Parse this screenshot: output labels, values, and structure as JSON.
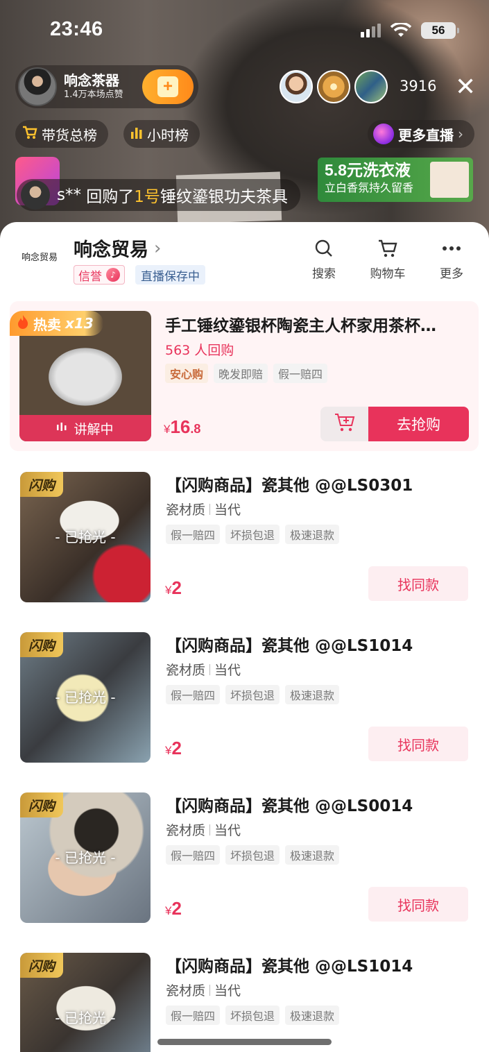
{
  "status": {
    "time": "23:46",
    "battery": "56"
  },
  "host": {
    "name": "响念茶器",
    "likes": "1.4万本场点赞",
    "follow_icon": "plus-heart-icon"
  },
  "viewers": {
    "count": "3916"
  },
  "chips": {
    "sales_rank": "带货总榜",
    "hour_rank": "小时榜",
    "more_live": "更多直播"
  },
  "ad": {
    "title": "5.8元洗衣液",
    "subtitle": "立白香氛持久留香"
  },
  "notice": {
    "user": "s**",
    "action_pre": "回购了",
    "num": "1号",
    "product": "锤纹鎏银功夫茶具"
  },
  "shop": {
    "logo_text": "响念贸易",
    "name": "响念贸易",
    "credit_tag": "信誉",
    "save_tag": "直播保存中",
    "actions": [
      {
        "label": "搜索",
        "icon": "search-icon"
      },
      {
        "label": "购物车",
        "icon": "cart-icon"
      },
      {
        "label": "更多",
        "icon": "more-dots-icon"
      }
    ]
  },
  "featured": {
    "hot_label": "热卖",
    "hot_count": "x13",
    "title": "手工锤纹鎏银杯陶瓷主人杯家用茶杯…",
    "repurchase": "563 人回购",
    "tags": [
      "安心购",
      "晚发即赔",
      "假一赔四"
    ],
    "explain_label": "讲解中",
    "price_symbol": "¥",
    "price_int": "16",
    "price_dec": ".8",
    "buy_label": "去抢购"
  },
  "items": [
    {
      "flash": "闪购",
      "soldout": "- 已抢光 -",
      "title": "【闪购商品】瓷其他 @@LS0301",
      "material": "瓷材质",
      "era": "当代",
      "tags": [
        "假一赔四",
        "坏损包退",
        "极速退款"
      ],
      "price_symbol": "¥",
      "price": "2",
      "button": "找同款"
    },
    {
      "flash": "闪购",
      "soldout": "- 已抢光 -",
      "title": "【闪购商品】瓷其他 @@LS1014",
      "material": "瓷材质",
      "era": "当代",
      "tags": [
        "假一赔四",
        "坏损包退",
        "极速退款"
      ],
      "price_symbol": "¥",
      "price": "2",
      "button": "找同款"
    },
    {
      "flash": "闪购",
      "soldout": "- 已抢光 -",
      "title": "【闪购商品】瓷其他 @@LS0014",
      "material": "瓷材质",
      "era": "当代",
      "tags": [
        "假一赔四",
        "坏损包退",
        "极速退款"
      ],
      "price_symbol": "¥",
      "price": "2",
      "button": "找同款"
    },
    {
      "flash": "闪购",
      "soldout": "- 已抢光 -",
      "title": "【闪购商品】瓷其他 @@LS1014",
      "material": "瓷材质",
      "era": "当代",
      "tags": [
        "假一赔四",
        "坏损包退",
        "极速退款"
      ]
    }
  ],
  "colors": {
    "accent": "#e8335b",
    "flash_gold": "#f0c75a",
    "hot_orange": "#ff9a2e"
  }
}
